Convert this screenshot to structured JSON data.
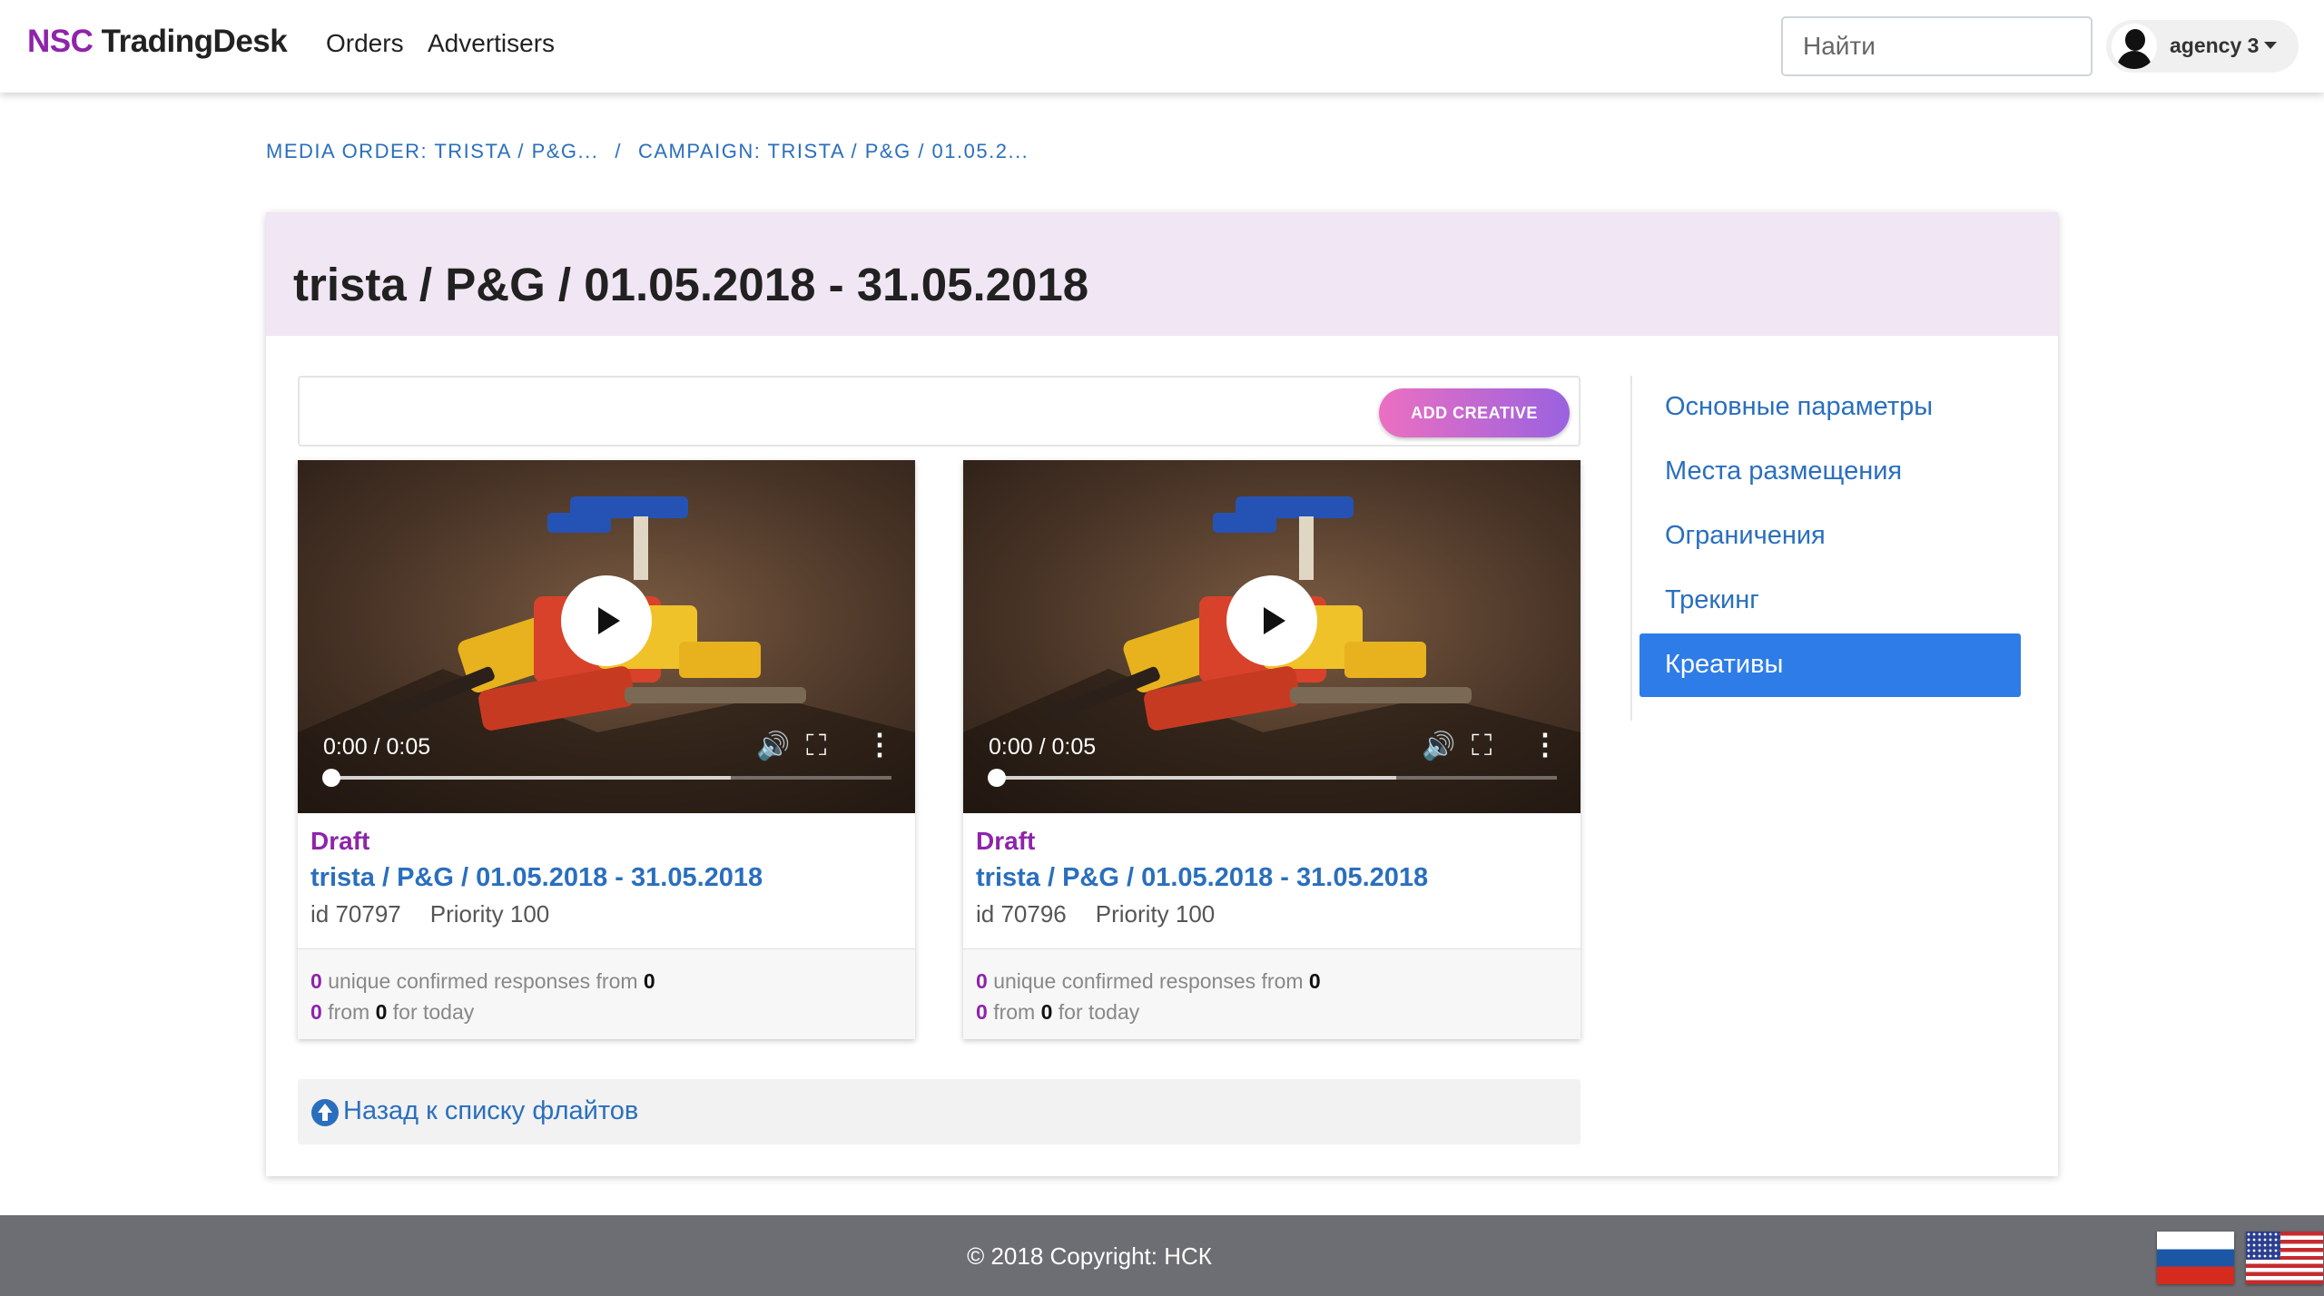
{
  "navbar": {
    "brand_prefix": "NSC",
    "brand_suffix": "TradingDesk",
    "links": [
      "Orders",
      "Advertisers"
    ],
    "search_placeholder": "Найти",
    "user_name": "agency 3"
  },
  "breadcrumb": {
    "items": [
      "MEDIA ORDER: TRISTA / P&G...",
      "CAMPAIGN: TRISTA / P&G / 01.05.2..."
    ],
    "separator": "/"
  },
  "page": {
    "title": "trista / P&G / 01.05.2018 - 31.05.2018",
    "add_creative_label": "ADD CREATIVE",
    "back_label": "Назад к списку флайтов"
  },
  "creatives": [
    {
      "status": "Draft",
      "name": "trista / P&G / 01.05.2018 - 31.05.2018",
      "id_label": "id 70797",
      "priority_label": "Priority 100",
      "time": "0:00 / 0:05",
      "stats": {
        "unique": "0",
        "unique_text": "unique confirmed responses from",
        "unique_total": "0",
        "today": "0",
        "today_from": "from",
        "today_total": "0",
        "today_text": "for today"
      }
    },
    {
      "status": "Draft",
      "name": "trista / P&G / 01.05.2018 - 31.05.2018",
      "id_label": "id 70796",
      "priority_label": "Priority 100",
      "time": "0:00 / 0:05",
      "stats": {
        "unique": "0",
        "unique_text": "unique confirmed responses from",
        "unique_total": "0",
        "today": "0",
        "today_from": "from",
        "today_total": "0",
        "today_text": "for today"
      }
    }
  ],
  "sidebar": {
    "items": [
      {
        "label": "Основные параметры",
        "active": false
      },
      {
        "label": "Места размещения",
        "active": false
      },
      {
        "label": "Ограничения",
        "active": false
      },
      {
        "label": "Трекинг",
        "active": false
      },
      {
        "label": "Креативы",
        "active": true
      }
    ]
  },
  "footer": {
    "copyright": "© 2018 Copyright: НСК"
  },
  "icons": {
    "play": "play-icon",
    "volume": "volume-icon",
    "fullscreen": "fullscreen-icon",
    "more": "more-vertical-icon",
    "back": "arrow-circle-up-icon"
  },
  "colors": {
    "accent_purple": "#8e24aa",
    "link_blue": "#2a6fbd",
    "active_blue": "#2d7ce8",
    "header_bg": "#f1e6f3",
    "footer_bg": "#6c6e73"
  }
}
